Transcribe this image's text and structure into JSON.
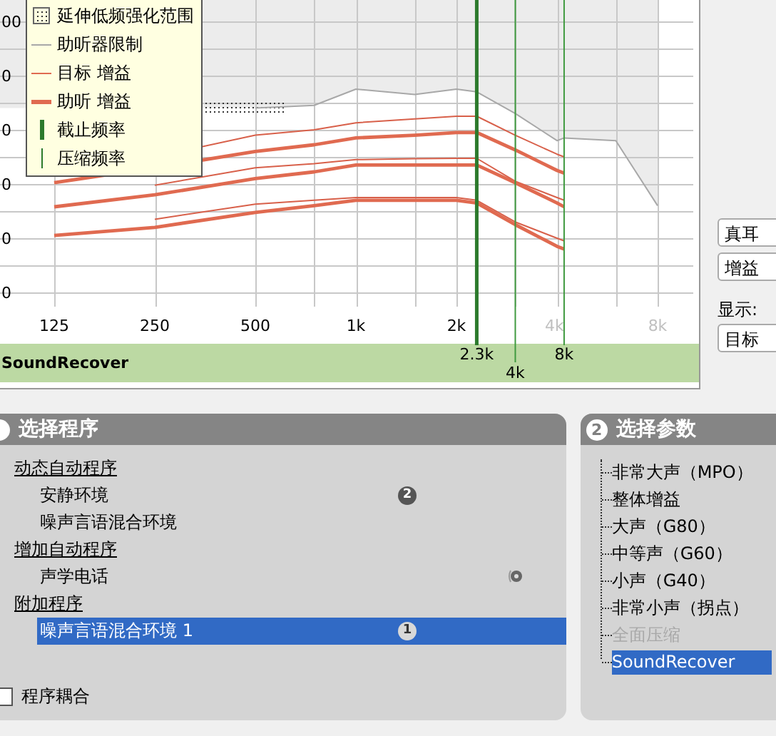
{
  "chart": {
    "legend": [
      {
        "kind": "hatch",
        "label": "延伸低频强化范围"
      },
      {
        "kind": "limit",
        "label": "助听器限制"
      },
      {
        "kind": "target",
        "label": "目标 增益"
      },
      {
        "kind": "gain",
        "label": "助听 增益"
      },
      {
        "kind": "cutoff",
        "label": "截止频率"
      },
      {
        "kind": "compression",
        "label": "压缩频率"
      }
    ],
    "y_labels": [
      "00",
      "0",
      "0",
      "0",
      "0",
      "0"
    ],
    "x_labels": [
      {
        "label": "125",
        "dimmed": false
      },
      {
        "label": "250",
        "dimmed": false
      },
      {
        "label": "500",
        "dimmed": false
      },
      {
        "label": "1k",
        "dimmed": false
      },
      {
        "label": "2k",
        "dimmed": false
      },
      {
        "label": "4k",
        "dimmed": true
      },
      {
        "label": "8k",
        "dimmed": true
      }
    ],
    "markers": [
      {
        "kind": "cutoff",
        "label": "2.3k"
      },
      {
        "kind": "compression",
        "label": "4k"
      },
      {
        "kind": "compression",
        "label": "8k"
      }
    ],
    "band_label": "SoundRecover"
  },
  "view_controls": [
    {
      "kind": "dropdown",
      "value": "真耳"
    },
    {
      "kind": "dropdown",
      "value": "增益"
    },
    {
      "kind": "label",
      "value": "显示:"
    },
    {
      "kind": "dropdown",
      "value": "目标"
    }
  ],
  "program_panel": {
    "title": "选择程序",
    "groups": [
      {
        "label": "动态自动程序",
        "items": [
          {
            "label": "安静环境",
            "selected": false,
            "badge": "2",
            "telecoil": false
          },
          {
            "label": "噪声言语混合环境",
            "selected": false,
            "telecoil": false
          }
        ]
      },
      {
        "label": "增加自动程序",
        "items": [
          {
            "label": "声学电话",
            "selected": false,
            "telecoil": true
          }
        ]
      },
      {
        "label": "附加程序",
        "items": [
          {
            "label": "噪声言语混合环境 1",
            "selected": true,
            "badge": "1",
            "telecoil": false
          }
        ]
      }
    ],
    "coupling": {
      "label": "程序耦合",
      "checked": false
    }
  },
  "parameter_panel": {
    "number": "2",
    "title": "选择参数",
    "items": [
      {
        "label": "非常大声（MPO）",
        "selected": false,
        "disabled": false
      },
      {
        "label": "整体增益",
        "selected": false,
        "disabled": false
      },
      {
        "label": "大声（G80）",
        "selected": false,
        "disabled": false
      },
      {
        "label": "中等声（G60）",
        "selected": false,
        "disabled": false
      },
      {
        "label": "小声（G40）",
        "selected": false,
        "disabled": false
      },
      {
        "label": "非常小声（拐点）",
        "selected": false,
        "disabled": false
      },
      {
        "label": "全面压缩",
        "selected": false,
        "disabled": true
      },
      {
        "label": "SoundRecover",
        "selected": true,
        "disabled": false
      }
    ]
  }
}
